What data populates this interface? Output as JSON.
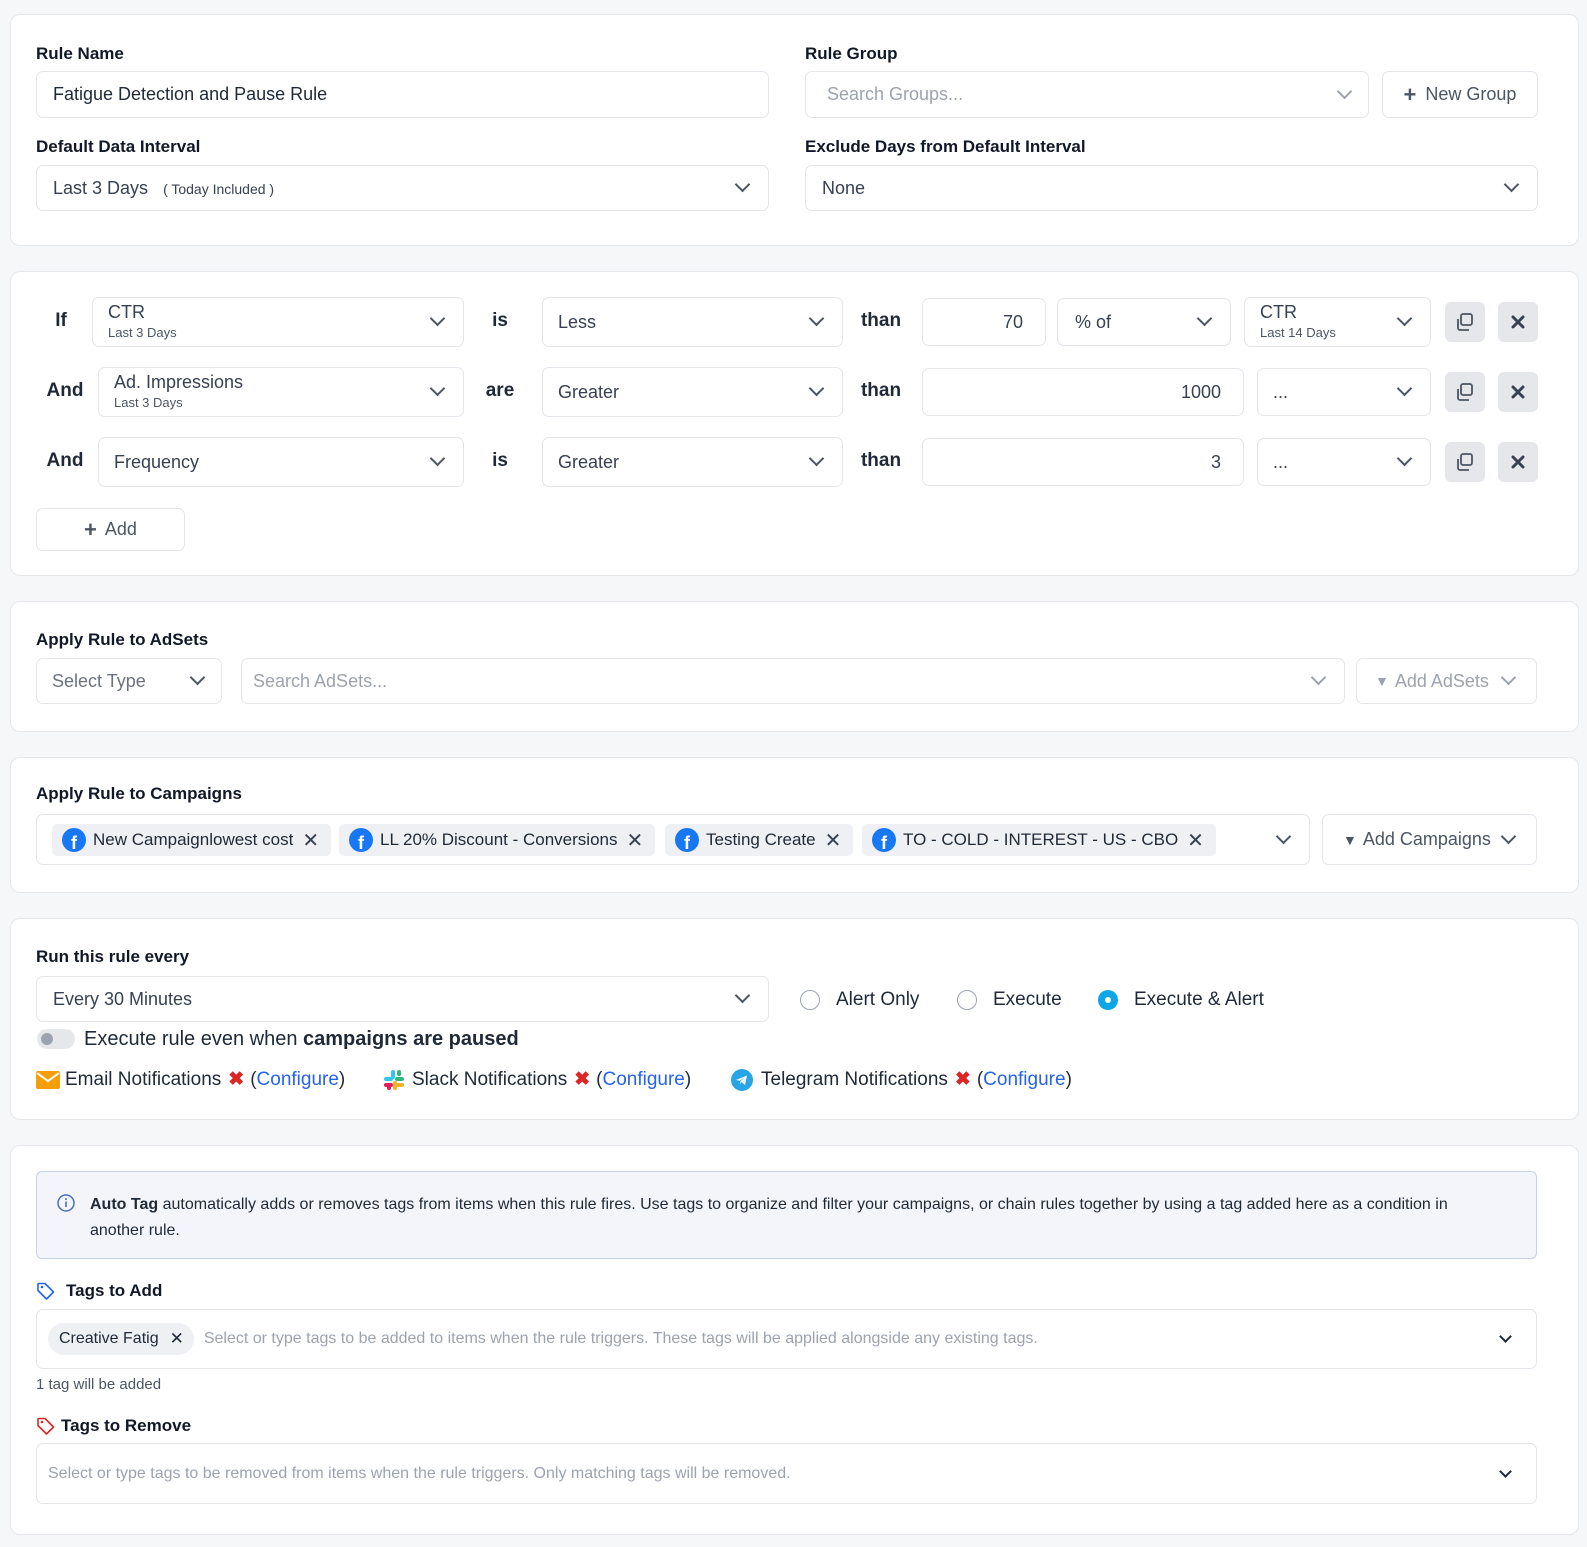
{
  "rule": {
    "name_label": "Rule Name",
    "name_value": "Fatigue Detection and Pause Rule",
    "group_label": "Rule Group",
    "group_placeholder": "Search Groups...",
    "new_group_label": "New Group",
    "interval_label": "Default Data Interval",
    "interval_value": "Last 3 Days",
    "interval_note": "( Today Included )",
    "exclude_label": "Exclude Days from Default Interval",
    "exclude_value": "None"
  },
  "conditions": {
    "rows": [
      {
        "connector": "If",
        "metric": "CTR",
        "metric_interval": "Last 3 Days",
        "verb": "is",
        "operator": "Less",
        "than": "than",
        "value": "70",
        "mode": "% of",
        "compare_metric": "CTR",
        "compare_interval": "Last 14 Days"
      },
      {
        "connector": "And",
        "metric": "Ad. Impressions",
        "metric_interval": "Last 3 Days",
        "verb": "are",
        "operator": "Greater",
        "than": "than",
        "value": "1000",
        "mode": "..."
      },
      {
        "connector": "And",
        "metric": "Frequency",
        "verb": "is",
        "operator": "Greater",
        "than": "than",
        "value": "3",
        "mode": "..."
      }
    ],
    "add_label": "Add"
  },
  "adsets": {
    "label": "Apply Rule to AdSets",
    "type_placeholder": "Select Type",
    "search_placeholder": "Search AdSets...",
    "add_label": "Add AdSets"
  },
  "campaigns": {
    "label": "Apply Rule to Campaigns",
    "selected": [
      "New Campaignlowest cost",
      "LL 20% Discount - Conversions",
      "Testing Create",
      "TO - COLD - INTEREST - US - CBO"
    ],
    "add_label": "Add Campaigns"
  },
  "schedule": {
    "label": "Run this rule every",
    "frequency_value": "Every 30 Minutes",
    "options": [
      "Alert Only",
      "Execute",
      "Execute & Alert"
    ],
    "selected_option": "Execute & Alert",
    "paused_toggle_prefix": "Execute rule even when",
    "paused_toggle_bold": "campaigns are paused",
    "paused_toggle_on": false,
    "notifications": [
      {
        "name": "Email Notifications",
        "configure": "Configure"
      },
      {
        "name": "Slack Notifications",
        "configure": "Configure"
      },
      {
        "name": "Telegram Notifications",
        "configure": "Configure"
      }
    ]
  },
  "autotag": {
    "info_bold": "Auto Tag",
    "info_text": "automatically adds or removes tags from items when this rule fires. Use tags to organize and filter your campaigns, or chain rules together by using a tag added here as a condition in another rule.",
    "add_label": "Tags to Add",
    "add_tags": [
      "Creative Fatig"
    ],
    "add_placeholder": "Select or type tags to be added to items when the rule triggers. These tags will be applied alongside any existing tags.",
    "add_count_text": "1 tag will be added",
    "remove_label": "Tags to Remove",
    "remove_placeholder": "Select or type tags to be removed from items when the rule triggers. Only matching tags will be removed."
  },
  "colors": {
    "accent": "#0ea5e9",
    "facebook": "#1877f2",
    "danger": "#dc2626",
    "link": "#2563eb",
    "info_bg": "#f3f5fb"
  }
}
